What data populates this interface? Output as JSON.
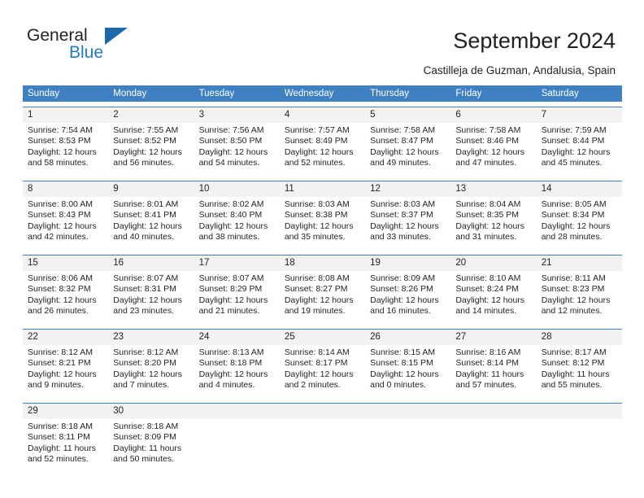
{
  "brand": {
    "name_top": "General",
    "name_bottom": "Blue",
    "accent_color": "#1b68ad",
    "logo_icon": "triangle-flag-icon"
  },
  "header": {
    "title": "September 2024",
    "subtitle": "Castilleja de Guzman, Andalusia, Spain"
  },
  "theme": {
    "header_row_bg": "#3f80c2",
    "header_row_text": "#ffffff",
    "daynum_bg": "#f2f2f2",
    "row_divider": "#3f80c2",
    "body_text": "#231f20"
  },
  "calendar": {
    "weekdays": [
      "Sunday",
      "Monday",
      "Tuesday",
      "Wednesday",
      "Thursday",
      "Friday",
      "Saturday"
    ],
    "weeks": [
      {
        "days": [
          {
            "num": "1",
            "sunrise": "Sunrise: 7:54 AM",
            "sunset": "Sunset: 8:53 PM",
            "daylight1": "Daylight: 12 hours",
            "daylight2": "and 58 minutes."
          },
          {
            "num": "2",
            "sunrise": "Sunrise: 7:55 AM",
            "sunset": "Sunset: 8:52 PM",
            "daylight1": "Daylight: 12 hours",
            "daylight2": "and 56 minutes."
          },
          {
            "num": "3",
            "sunrise": "Sunrise: 7:56 AM",
            "sunset": "Sunset: 8:50 PM",
            "daylight1": "Daylight: 12 hours",
            "daylight2": "and 54 minutes."
          },
          {
            "num": "4",
            "sunrise": "Sunrise: 7:57 AM",
            "sunset": "Sunset: 8:49 PM",
            "daylight1": "Daylight: 12 hours",
            "daylight2": "and 52 minutes."
          },
          {
            "num": "5",
            "sunrise": "Sunrise: 7:58 AM",
            "sunset": "Sunset: 8:47 PM",
            "daylight1": "Daylight: 12 hours",
            "daylight2": "and 49 minutes."
          },
          {
            "num": "6",
            "sunrise": "Sunrise: 7:58 AM",
            "sunset": "Sunset: 8:46 PM",
            "daylight1": "Daylight: 12 hours",
            "daylight2": "and 47 minutes."
          },
          {
            "num": "7",
            "sunrise": "Sunrise: 7:59 AM",
            "sunset": "Sunset: 8:44 PM",
            "daylight1": "Daylight: 12 hours",
            "daylight2": "and 45 minutes."
          }
        ]
      },
      {
        "days": [
          {
            "num": "8",
            "sunrise": "Sunrise: 8:00 AM",
            "sunset": "Sunset: 8:43 PM",
            "daylight1": "Daylight: 12 hours",
            "daylight2": "and 42 minutes."
          },
          {
            "num": "9",
            "sunrise": "Sunrise: 8:01 AM",
            "sunset": "Sunset: 8:41 PM",
            "daylight1": "Daylight: 12 hours",
            "daylight2": "and 40 minutes."
          },
          {
            "num": "10",
            "sunrise": "Sunrise: 8:02 AM",
            "sunset": "Sunset: 8:40 PM",
            "daylight1": "Daylight: 12 hours",
            "daylight2": "and 38 minutes."
          },
          {
            "num": "11",
            "sunrise": "Sunrise: 8:03 AM",
            "sunset": "Sunset: 8:38 PM",
            "daylight1": "Daylight: 12 hours",
            "daylight2": "and 35 minutes."
          },
          {
            "num": "12",
            "sunrise": "Sunrise: 8:03 AM",
            "sunset": "Sunset: 8:37 PM",
            "daylight1": "Daylight: 12 hours",
            "daylight2": "and 33 minutes."
          },
          {
            "num": "13",
            "sunrise": "Sunrise: 8:04 AM",
            "sunset": "Sunset: 8:35 PM",
            "daylight1": "Daylight: 12 hours",
            "daylight2": "and 31 minutes."
          },
          {
            "num": "14",
            "sunrise": "Sunrise: 8:05 AM",
            "sunset": "Sunset: 8:34 PM",
            "daylight1": "Daylight: 12 hours",
            "daylight2": "and 28 minutes."
          }
        ]
      },
      {
        "days": [
          {
            "num": "15",
            "sunrise": "Sunrise: 8:06 AM",
            "sunset": "Sunset: 8:32 PM",
            "daylight1": "Daylight: 12 hours",
            "daylight2": "and 26 minutes."
          },
          {
            "num": "16",
            "sunrise": "Sunrise: 8:07 AM",
            "sunset": "Sunset: 8:31 PM",
            "daylight1": "Daylight: 12 hours",
            "daylight2": "and 23 minutes."
          },
          {
            "num": "17",
            "sunrise": "Sunrise: 8:07 AM",
            "sunset": "Sunset: 8:29 PM",
            "daylight1": "Daylight: 12 hours",
            "daylight2": "and 21 minutes."
          },
          {
            "num": "18",
            "sunrise": "Sunrise: 8:08 AM",
            "sunset": "Sunset: 8:27 PM",
            "daylight1": "Daylight: 12 hours",
            "daylight2": "and 19 minutes."
          },
          {
            "num": "19",
            "sunrise": "Sunrise: 8:09 AM",
            "sunset": "Sunset: 8:26 PM",
            "daylight1": "Daylight: 12 hours",
            "daylight2": "and 16 minutes."
          },
          {
            "num": "20",
            "sunrise": "Sunrise: 8:10 AM",
            "sunset": "Sunset: 8:24 PM",
            "daylight1": "Daylight: 12 hours",
            "daylight2": "and 14 minutes."
          },
          {
            "num": "21",
            "sunrise": "Sunrise: 8:11 AM",
            "sunset": "Sunset: 8:23 PM",
            "daylight1": "Daylight: 12 hours",
            "daylight2": "and 12 minutes."
          }
        ]
      },
      {
        "days": [
          {
            "num": "22",
            "sunrise": "Sunrise: 8:12 AM",
            "sunset": "Sunset: 8:21 PM",
            "daylight1": "Daylight: 12 hours",
            "daylight2": "and 9 minutes."
          },
          {
            "num": "23",
            "sunrise": "Sunrise: 8:12 AM",
            "sunset": "Sunset: 8:20 PM",
            "daylight1": "Daylight: 12 hours",
            "daylight2": "and 7 minutes."
          },
          {
            "num": "24",
            "sunrise": "Sunrise: 8:13 AM",
            "sunset": "Sunset: 8:18 PM",
            "daylight1": "Daylight: 12 hours",
            "daylight2": "and 4 minutes."
          },
          {
            "num": "25",
            "sunrise": "Sunrise: 8:14 AM",
            "sunset": "Sunset: 8:17 PM",
            "daylight1": "Daylight: 12 hours",
            "daylight2": "and 2 minutes."
          },
          {
            "num": "26",
            "sunrise": "Sunrise: 8:15 AM",
            "sunset": "Sunset: 8:15 PM",
            "daylight1": "Daylight: 12 hours",
            "daylight2": "and 0 minutes."
          },
          {
            "num": "27",
            "sunrise": "Sunrise: 8:16 AM",
            "sunset": "Sunset: 8:14 PM",
            "daylight1": "Daylight: 11 hours",
            "daylight2": "and 57 minutes."
          },
          {
            "num": "28",
            "sunrise": "Sunrise: 8:17 AM",
            "sunset": "Sunset: 8:12 PM",
            "daylight1": "Daylight: 11 hours",
            "daylight2": "and 55 minutes."
          }
        ]
      },
      {
        "days": [
          {
            "num": "29",
            "sunrise": "Sunrise: 8:18 AM",
            "sunset": "Sunset: 8:11 PM",
            "daylight1": "Daylight: 11 hours",
            "daylight2": "and 52 minutes."
          },
          {
            "num": "30",
            "sunrise": "Sunrise: 8:18 AM",
            "sunset": "Sunset: 8:09 PM",
            "daylight1": "Daylight: 11 hours",
            "daylight2": "and 50 minutes."
          },
          {
            "num": "",
            "sunrise": "",
            "sunset": "",
            "daylight1": "",
            "daylight2": ""
          },
          {
            "num": "",
            "sunrise": "",
            "sunset": "",
            "daylight1": "",
            "daylight2": ""
          },
          {
            "num": "",
            "sunrise": "",
            "sunset": "",
            "daylight1": "",
            "daylight2": ""
          },
          {
            "num": "",
            "sunrise": "",
            "sunset": "",
            "daylight1": "",
            "daylight2": ""
          },
          {
            "num": "",
            "sunrise": "",
            "sunset": "",
            "daylight1": "",
            "daylight2": ""
          }
        ]
      }
    ]
  }
}
